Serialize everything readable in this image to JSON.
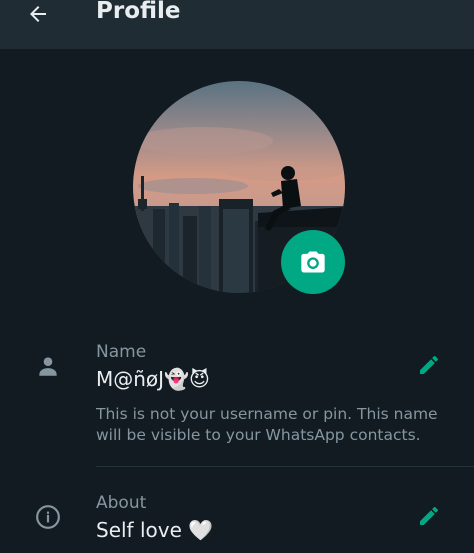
{
  "header": {
    "title": "Profile",
    "back_icon": "arrow-left-icon"
  },
  "avatar": {
    "camera_icon": "camera-icon",
    "accent": "#00a884"
  },
  "name_section": {
    "label": "Name",
    "value": "M@ñøJ👻😈",
    "hint": "This is not your username or pin. This name will be visible to your WhatsApp contacts.",
    "icon": "person-icon",
    "edit_icon": "pencil-icon"
  },
  "about_section": {
    "label": "About",
    "value": "Self love 🤍",
    "icon": "info-icon",
    "edit_icon": "pencil-icon"
  },
  "colors": {
    "background": "#111b21",
    "header": "#1f2c34",
    "accent": "#00a884",
    "secondary_text": "#8696a0"
  }
}
